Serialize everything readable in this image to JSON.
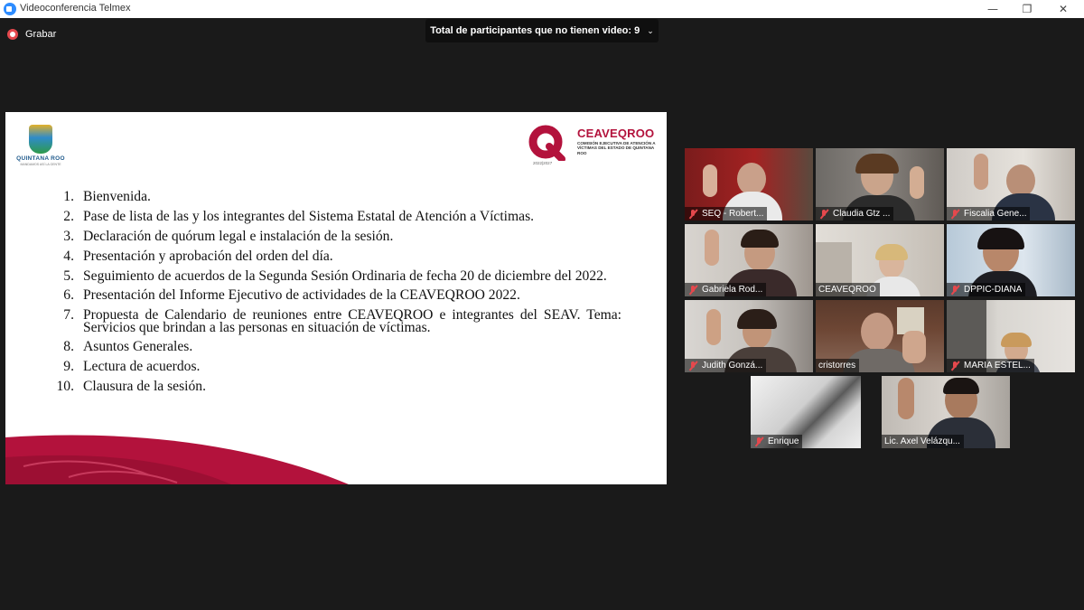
{
  "window": {
    "title": "Videoconferencia Telmex",
    "minimize": "—",
    "maximize": "❐",
    "close": "✕"
  },
  "record": {
    "label": "Grabar"
  },
  "banner": {
    "text": "Total de participantes que no tienen video: 9",
    "chevron": "⌄"
  },
  "slide": {
    "left_logo": {
      "name": "QUINTANA ROO",
      "sub": "MANDAMOS ASÍ LA GENTE"
    },
    "right_logo": {
      "name": "CEAVEQROO",
      "description": "COMISIÓN EJECUTIVA DE ATENCIÓN A VÍCTIMAS DEL ESTADO DE QUINTANA ROO",
      "years": "2022|2027"
    },
    "agenda": [
      {
        "num": "1.",
        "text": "Bienvenida."
      },
      {
        "num": "2.",
        "text": "Pase de lista de las y los integrantes del Sistema Estatal de Atención a Víctimas."
      },
      {
        "num": "3.",
        "text": "Declaración de quórum legal e instalación de la sesión."
      },
      {
        "num": "4.",
        "text": "Presentación y aprobación del orden del día."
      },
      {
        "num": "5.",
        "text": "Seguimiento de acuerdos de la Segunda Sesión Ordinaria de fecha 20 de diciembre del 2022."
      },
      {
        "num": "6.",
        "text": "Presentación del Informe Ejecutivo de actividades de la CEAVEQROO 2022."
      },
      {
        "num": "7.",
        "text": "Propuesta de Calendario de reuniones entre CEAVEQROO e integrantes del SEAV. Tema: Servicios que brindan a las personas en situación de víctimas."
      },
      {
        "num": "8.",
        "text": "Asuntos Generales."
      },
      {
        "num": "9.",
        "text": "Lectura de acuerdos."
      },
      {
        "num": "10.",
        "text": "Clausura de la sesión."
      }
    ]
  },
  "participants": [
    {
      "name": "SEQ - Robert...",
      "muted": true,
      "active": false
    },
    {
      "name": "Claudia Gtz ...",
      "muted": true,
      "active": false
    },
    {
      "name": "Fiscalia Gene...",
      "muted": true,
      "active": false
    },
    {
      "name": "Gabriela Rod...",
      "muted": true,
      "active": false
    },
    {
      "name": "CEAVEQROO",
      "muted": false,
      "active": false
    },
    {
      "name": "DPPIC-DIANA",
      "muted": true,
      "active": false
    },
    {
      "name": "Judith Gonzá...",
      "muted": true,
      "active": false
    },
    {
      "name": "cristorres",
      "muted": false,
      "active": true
    },
    {
      "name": "MARIA ESTEL...",
      "muted": true,
      "active": false
    },
    {
      "name": "Enrique",
      "muted": true,
      "active": false
    },
    {
      "name": "Lic. Axel Velázqu...",
      "muted": false,
      "active": false
    }
  ],
  "colors": {
    "meeting_bg": "#1a1a1a",
    "brand_red": "#b3123c",
    "active_speaker": "#c4d93a",
    "muted_icon": "#e5484d"
  }
}
